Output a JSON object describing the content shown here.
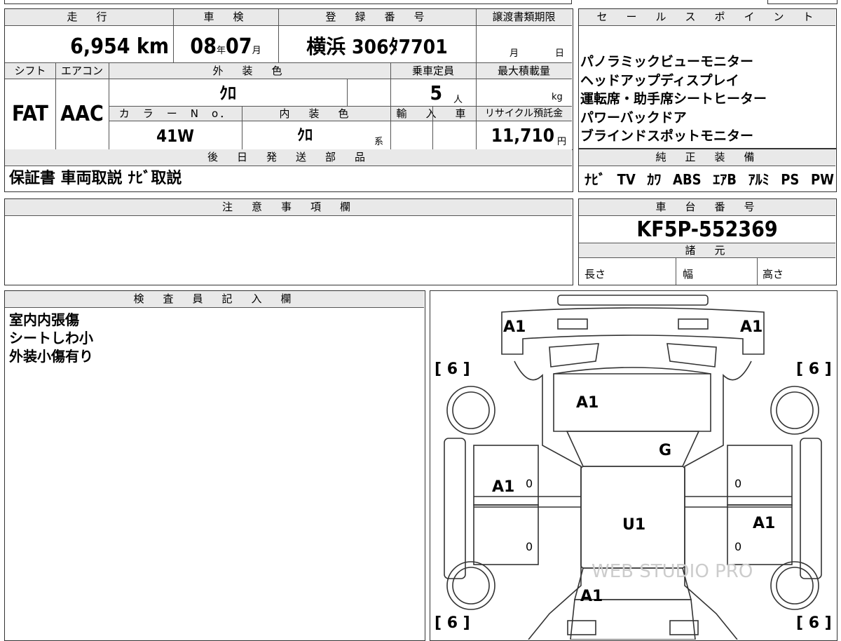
{
  "main_info": {
    "headers": {
      "mileage": "走　行",
      "inspection": "車　検",
      "registration": "登　録　番　号",
      "doc_deadline": "譲渡書類期限",
      "shift": "シフト",
      "aircon": "エアコン",
      "exterior_color": "外　装　色",
      "capacity": "乗車定員",
      "max_load": "最大積載量",
      "color_no": "カ　ラ　ー　N　o．",
      "interior_color": "内　装　色",
      "import": "輸　入　車",
      "recycle": "リサイクル預託金"
    },
    "mileage_value": "6,954",
    "mileage_unit": "km",
    "inspection_year": "08",
    "inspection_year_unit": "年",
    "inspection_month": "07",
    "inspection_month_unit": "月",
    "registration_number": "横浜 306ﾀ7701",
    "doc_month_unit": "月",
    "doc_day_unit": "日",
    "shift_value": "FAT",
    "aircon_value": "AAC",
    "exterior_color_value": "ｸﾛ",
    "capacity_value": "5",
    "capacity_unit": "人",
    "max_load_unit": "kg",
    "color_no_value": "41W",
    "interior_color_value": "ｸﾛ",
    "interior_color_suffix": "系",
    "recycle_value": "11,710",
    "recycle_unit": "円",
    "later_parts_header": "後　日　発　送　部　品",
    "later_parts_value": "保証書 車両取説 ﾅﾋﾞ取説"
  },
  "sales_points": {
    "header": "セ　ー　ル　ス　ポ　イ　ン　ト",
    "items": [
      "パノラミックビューモニター",
      "ヘッドアップディスプレイ",
      "運転席・助手席シートヒーター",
      "パワーバックドア",
      "ブラインドスポットモニター"
    ]
  },
  "genuine_equipment": {
    "header": "純　正　装　備",
    "items": [
      "ﾅﾋﾞ",
      "TV",
      "ｶﾜ",
      "ABS",
      "ｴｱB",
      "ｱﾙﾐ",
      "PS",
      "PW"
    ]
  },
  "notes": {
    "header": "注　意　事　項　欄"
  },
  "chassis": {
    "header": "車　台　番　号",
    "number": "KF5P-552369",
    "specs_header": "諸　元",
    "length_label": "長さ",
    "width_label": "幅",
    "height_label": "高さ"
  },
  "inspector": {
    "header": "検　査　員　記　入　欄",
    "lines": [
      "室内内張傷",
      "シートしわ小",
      "外装小傷有り"
    ]
  },
  "damage_map": {
    "marks": {
      "front_left": "A1",
      "front_right": "A1",
      "bracket_top_left": "[ 6 ]",
      "bracket_top_right": "[ 6 ]",
      "bracket_bottom_left": "[ 6 ]",
      "bracket_bottom_right": "[ 6 ]",
      "hood": "A1",
      "windshield": "G",
      "left_front_door": "A1",
      "roof": "U1",
      "right_rear_door": "A1",
      "rear": "A1",
      "zero_1": "0",
      "zero_2": "0",
      "zero_3": "0",
      "zero_4": "0"
    },
    "watermark": "WEB STUDIO PRO"
  }
}
